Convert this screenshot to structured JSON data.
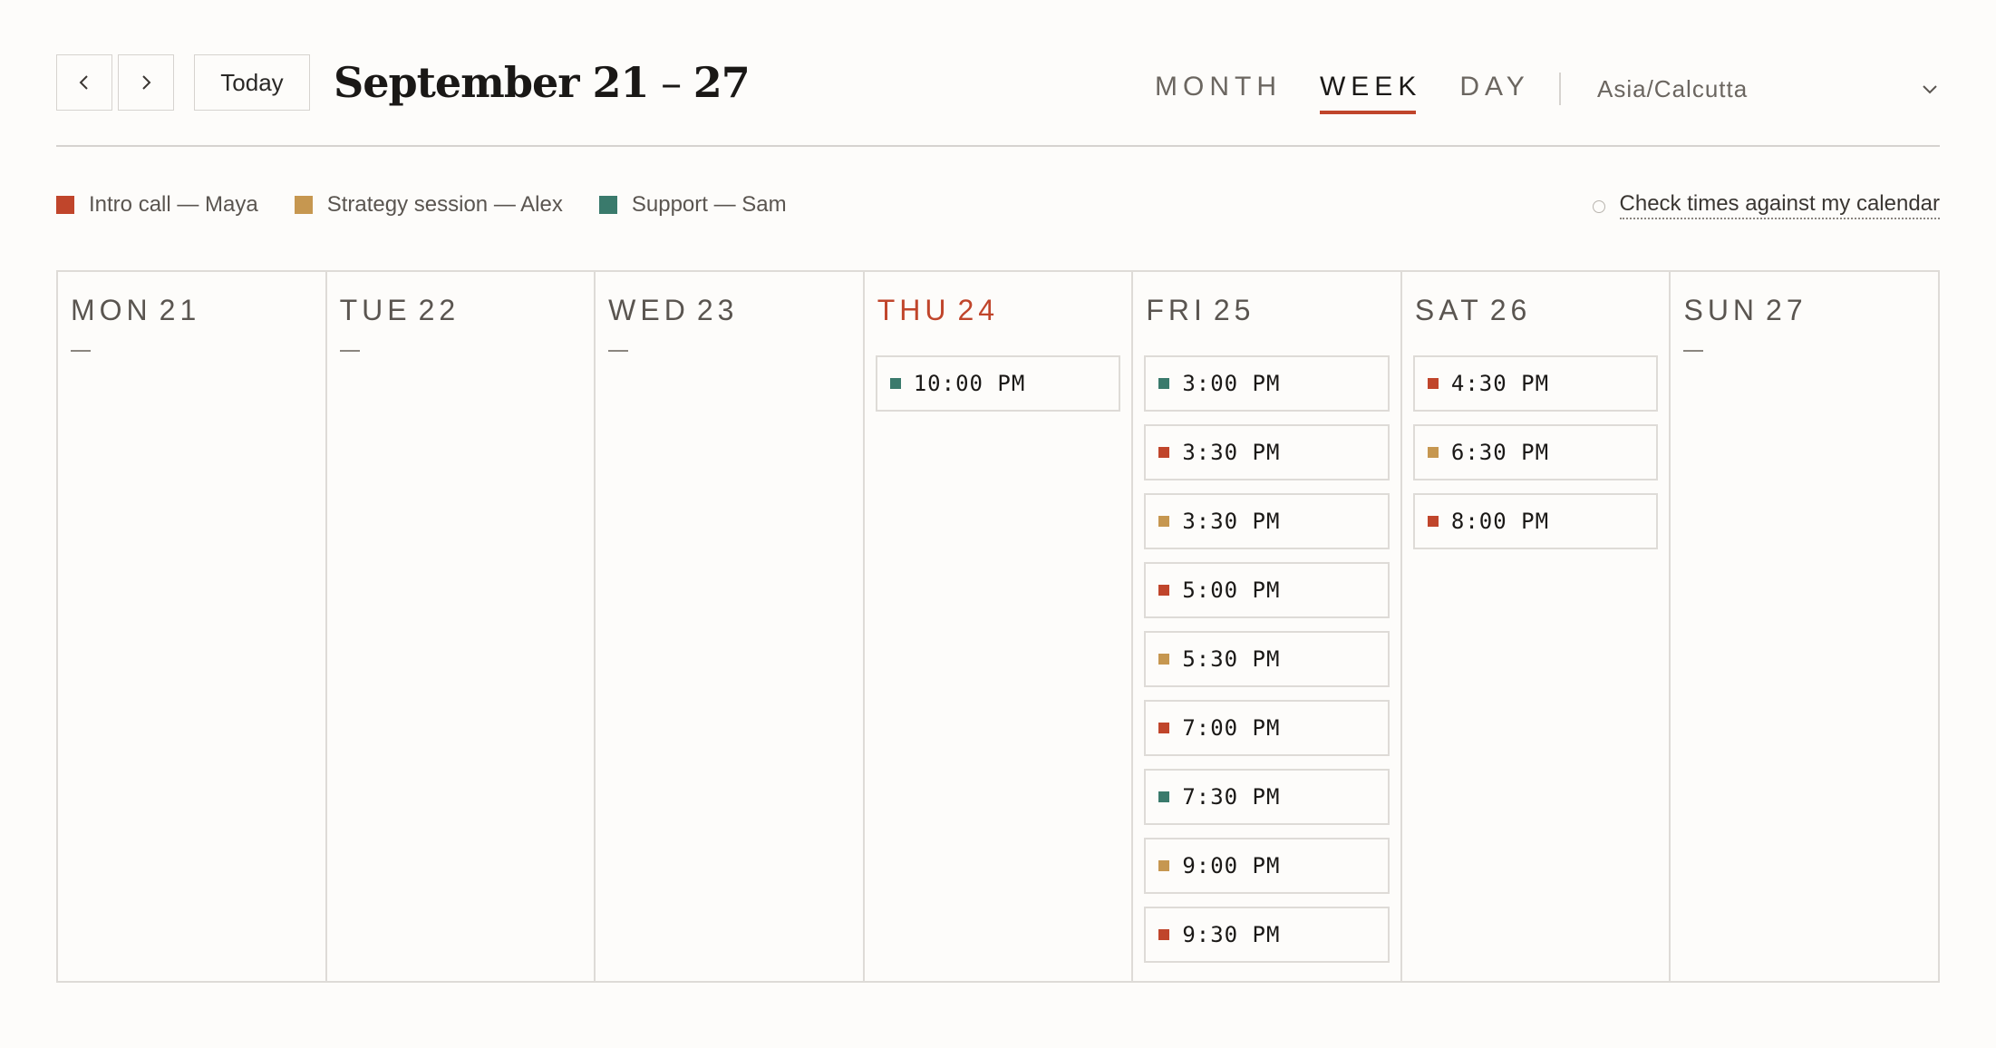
{
  "header": {
    "prev_icon": "chevron-left-icon",
    "next_icon": "chevron-right-icon",
    "today_label": "Today",
    "range_start": "September 21",
    "range_sep": " – ",
    "range_end": "27"
  },
  "views": {
    "items": [
      "MONTH",
      "WEEK",
      "DAY"
    ],
    "active": "WEEK"
  },
  "timezone": {
    "value": "Asia/Calcutta",
    "icon": "chevron-down-icon"
  },
  "legend": [
    {
      "label": "Intro call — Maya",
      "color": "#c0452b"
    },
    {
      "label": "Strategy session — Alex",
      "color": "#c69750"
    },
    {
      "label": "Support — Sam",
      "color": "#3a7a6c"
    }
  ],
  "check_calendar": {
    "label": "Check times against my calendar"
  },
  "accent_color": "#c0452b",
  "days": [
    {
      "dow": "MON",
      "num": "21",
      "today": false,
      "empty_marker": "—",
      "slots": []
    },
    {
      "dow": "TUE",
      "num": "22",
      "today": false,
      "empty_marker": "—",
      "slots": []
    },
    {
      "dow": "WED",
      "num": "23",
      "today": false,
      "empty_marker": "—",
      "slots": []
    },
    {
      "dow": "THU",
      "num": "24",
      "today": true,
      "slots": [
        {
          "time": "10:00 PM",
          "type": 2
        }
      ]
    },
    {
      "dow": "FRI",
      "num": "25",
      "today": false,
      "slots": [
        {
          "time": "3:00 PM",
          "type": 2
        },
        {
          "time": "3:30 PM",
          "type": 0
        },
        {
          "time": "3:30 PM",
          "type": 1
        },
        {
          "time": "5:00 PM",
          "type": 0
        },
        {
          "time": "5:30 PM",
          "type": 1
        },
        {
          "time": "7:00 PM",
          "type": 0
        },
        {
          "time": "7:30 PM",
          "type": 2
        },
        {
          "time": "9:00 PM",
          "type": 1
        },
        {
          "time": "9:30 PM",
          "type": 0
        }
      ]
    },
    {
      "dow": "SAT",
      "num": "26",
      "today": false,
      "slots": [
        {
          "time": "4:30 PM",
          "type": 0
        },
        {
          "time": "6:30 PM",
          "type": 1
        },
        {
          "time": "8:00 PM",
          "type": 0
        }
      ]
    },
    {
      "dow": "SUN",
      "num": "27",
      "today": false,
      "empty_marker": "—",
      "slots": []
    }
  ]
}
